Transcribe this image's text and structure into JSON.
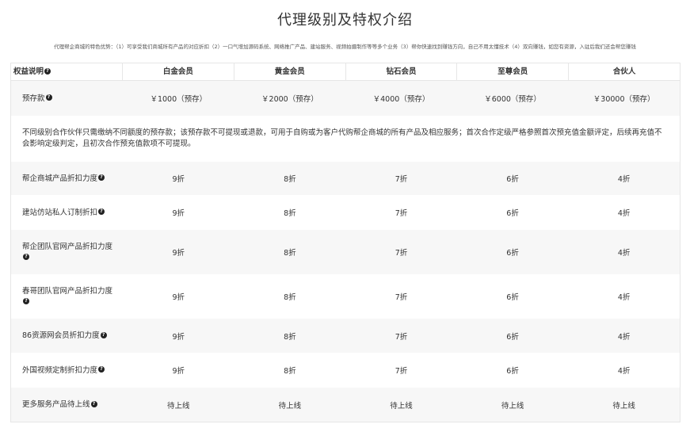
{
  "page": {
    "title": "代理级别及特权介绍",
    "intro": "代理帮企商城的特色优势：（1）可享受我们商城所有产品的对应折扣（2）一口气增加源码系统、网络推广产品、建站服务、视频拍摄制作等等多个业务（3）帮你快速找到赚钱方向，自己不用太懂技术（4）双向赚钱，如您有资源，入驻后我们还会帮您赚钱"
  },
  "table": {
    "header": {
      "label": "权益说明",
      "levels": [
        "白金会员",
        "黄金会员",
        "钻石会员",
        "至尊会员",
        "合伙人"
      ]
    },
    "deposit": {
      "label": "预存款",
      "values": [
        "￥1000（预存）",
        "￥2000（预存）",
        "￥4000（预存）",
        "￥6000（预存）",
        "￥30000（预存）"
      ]
    },
    "note": "不同级别合作伙伴只需缴纳不同额度的预存款；该预存款不可提现或退款，可用于自购或为客户代购帮企商城的所有产品及相应服务；首次合作定级严格参照首次预充值金额评定，后续再充值不会影响定级判定，且初次合作预充值款项不可提现。",
    "rows": [
      {
        "label": "帮企商城产品折扣力度",
        "values": [
          "9折",
          "8折",
          "7折",
          "6折",
          "4折"
        ]
      },
      {
        "label": "建站仿站私人订制折扣",
        "values": [
          "9折",
          "8折",
          "7折",
          "6折",
          "4折"
        ]
      },
      {
        "label": "帮企团队官网产品折扣力度",
        "values": [
          "9折",
          "8折",
          "7折",
          "6折",
          "4折"
        ]
      },
      {
        "label": "春哥团队官网产品折扣力度",
        "values": [
          "9折",
          "8折",
          "7折",
          "6折",
          "4折"
        ]
      },
      {
        "label": "86资源网会员折扣力度",
        "values": [
          "9折",
          "8折",
          "7折",
          "6折",
          "4折"
        ]
      },
      {
        "label": "外国视频定制折扣力度",
        "values": [
          "9折",
          "8折",
          "7折",
          "6折",
          "4折"
        ]
      },
      {
        "label": "更多服务产品待上线",
        "values": [
          "待上线",
          "待上线",
          "待上线",
          "待上线",
          "待上线"
        ]
      }
    ],
    "help_icon": "question-circle-icon"
  }
}
